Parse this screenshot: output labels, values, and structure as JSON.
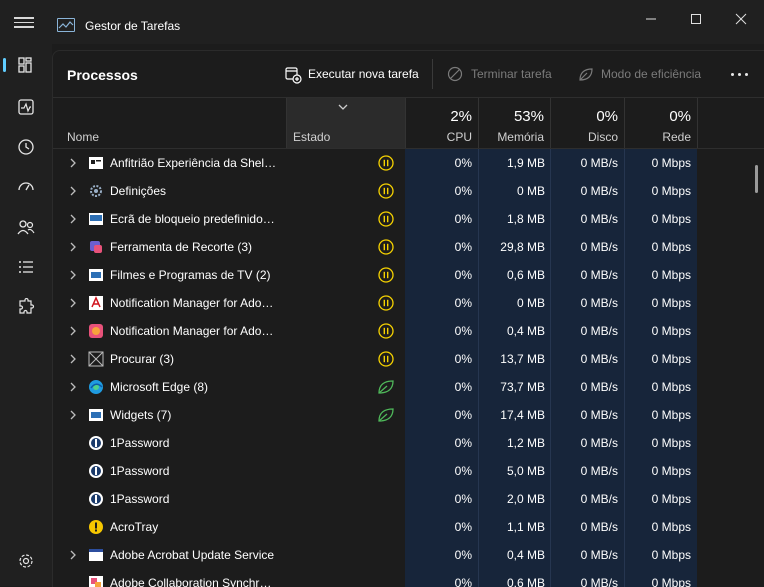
{
  "window": {
    "title": "Gestor de Tarefas",
    "accent": "#60cdff"
  },
  "nav": {
    "items": [
      {
        "icon": "processes-icon",
        "active": true
      },
      {
        "icon": "performance-icon"
      },
      {
        "icon": "app-history-icon"
      },
      {
        "icon": "startup-apps-icon"
      },
      {
        "icon": "users-icon"
      },
      {
        "icon": "details-icon"
      },
      {
        "icon": "services-icon"
      }
    ],
    "settings_icon": "gear-icon"
  },
  "toolbar": {
    "page_title": "Processos",
    "run_task": "Executar nova tarefa",
    "end_task": "Terminar tarefa",
    "efficiency_mode": "Modo de eficiência"
  },
  "columns": {
    "name": "Nome",
    "status": "Estado",
    "cpu": {
      "label": "CPU",
      "pct": "2%"
    },
    "memory": {
      "label": "Memória",
      "pct": "53%"
    },
    "disk": {
      "label": "Disco",
      "pct": "0%"
    },
    "network": {
      "label": "Rede",
      "pct": "0%"
    }
  },
  "processes": [
    {
      "name": "Anfitrião Experiência da Shell do Windows",
      "expandable": true,
      "icon": "shell-window-icon",
      "status": "pause-icon",
      "cpu": "0%",
      "memory": "1,9 MB",
      "disk": "0 MB/s",
      "network": "0 Mbps"
    },
    {
      "name": "Definições",
      "expandable": true,
      "icon": "settings-gear-icon",
      "status": "pause-icon",
      "cpu": "0%",
      "memory": "0 MB",
      "disk": "0 MB/s",
      "network": "0 Mbps"
    },
    {
      "name": "Ecrã de bloqueio predefinido do Windows",
      "expandable": true,
      "icon": "lockscreen-window-icon",
      "status": "pause-icon",
      "cpu": "0%",
      "memory": "1,8 MB",
      "disk": "0 MB/s",
      "network": "0 Mbps"
    },
    {
      "name": "Ferramenta de Recorte (3)",
      "expandable": true,
      "icon": "snipping-tool-icon",
      "status": "pause-icon",
      "cpu": "0%",
      "memory": "29,8 MB",
      "disk": "0 MB/s",
      "network": "0 Mbps"
    },
    {
      "name": "Filmes e Programas de TV (2)",
      "expandable": true,
      "icon": "movies-window-icon",
      "status": "pause-icon",
      "cpu": "0%",
      "memory": "0,6 MB",
      "disk": "0 MB/s",
      "network": "0 Mbps"
    },
    {
      "name": "Notification Manager for Adobe Acrobat",
      "expandable": true,
      "icon": "adobe-acrobat-icon",
      "status": "pause-icon",
      "cpu": "0%",
      "memory": "0 MB",
      "disk": "0 MB/s",
      "network": "0 Mbps"
    },
    {
      "name": "Notification Manager for Adobe Creative Cloud",
      "expandable": true,
      "icon": "creative-cloud-icon",
      "status": "pause-icon",
      "cpu": "0%",
      "memory": "0,4 MB",
      "disk": "0 MB/s",
      "network": "0 Mbps"
    },
    {
      "name": "Procurar (3)",
      "expandable": true,
      "icon": "search-app-icon",
      "status": "pause-icon",
      "cpu": "0%",
      "memory": "13,7 MB",
      "disk": "0 MB/s",
      "network": "0 Mbps"
    },
    {
      "name": "Microsoft Edge (8)",
      "expandable": true,
      "icon": "edge-icon",
      "status": "leaf-icon",
      "cpu": "0%",
      "memory": "73,7 MB",
      "disk": "0 MB/s",
      "network": "0 Mbps"
    },
    {
      "name": "Widgets (7)",
      "expandable": true,
      "icon": "widgets-window-icon",
      "status": "leaf-icon",
      "cpu": "0%",
      "memory": "17,4 MB",
      "disk": "0 MB/s",
      "network": "0 Mbps"
    },
    {
      "name": "1Password",
      "expandable": false,
      "icon": "1password-icon",
      "status": "",
      "cpu": "0%",
      "memory": "1,2 MB",
      "disk": "0 MB/s",
      "network": "0 Mbps"
    },
    {
      "name": "1Password",
      "expandable": false,
      "icon": "1password-icon",
      "status": "",
      "cpu": "0%",
      "memory": "5,0 MB",
      "disk": "0 MB/s",
      "network": "0 Mbps"
    },
    {
      "name": "1Password",
      "expandable": false,
      "icon": "1password-icon",
      "status": "",
      "cpu": "0%",
      "memory": "2,0 MB",
      "disk": "0 MB/s",
      "network": "0 Mbps"
    },
    {
      "name": "AcroTray",
      "expandable": false,
      "icon": "acrotray-icon",
      "status": "",
      "cpu": "0%",
      "memory": "1,1 MB",
      "disk": "0 MB/s",
      "network": "0 Mbps"
    },
    {
      "name": "Adobe Acrobat Update Service",
      "expandable": true,
      "icon": "acrobat-update-icon",
      "status": "",
      "cpu": "0%",
      "memory": "0,4 MB",
      "disk": "0 MB/s",
      "network": "0 Mbps"
    },
    {
      "name": "Adobe Collaboration Synchronizer",
      "expandable": false,
      "icon": "collab-sync-icon",
      "status": "",
      "cpu": "0%",
      "memory": "0,6 MB",
      "disk": "0 MB/s",
      "network": "0 Mbps"
    }
  ]
}
